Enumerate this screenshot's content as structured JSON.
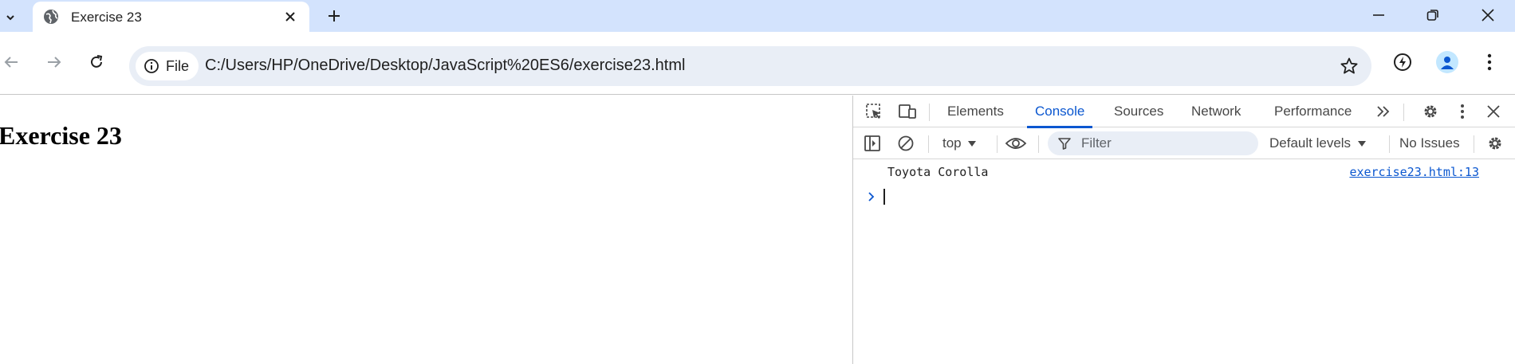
{
  "browser": {
    "tab_title": "Exercise 23",
    "address": {
      "chip_label": "File",
      "url": "C:/Users/HP/OneDrive/Desktop/JavaScript%20ES6/exercise23.html"
    }
  },
  "page": {
    "heading": "Exercise 23"
  },
  "devtools": {
    "tabs": [
      "Elements",
      "Console",
      "Sources",
      "Network",
      "Performance"
    ],
    "active_tab": "Console",
    "console_toolbar": {
      "context": "top",
      "filter_placeholder": "Filter",
      "levels": "Default levels",
      "issues": "No Issues"
    },
    "console_messages": [
      {
        "text": "Toyota Corolla",
        "source": "exercise23.html:13"
      }
    ]
  },
  "colors": {
    "tabstrip_bg": "#d3e3fd",
    "omnibox_bg": "#e9eef6",
    "accent": "#0b57d0"
  }
}
